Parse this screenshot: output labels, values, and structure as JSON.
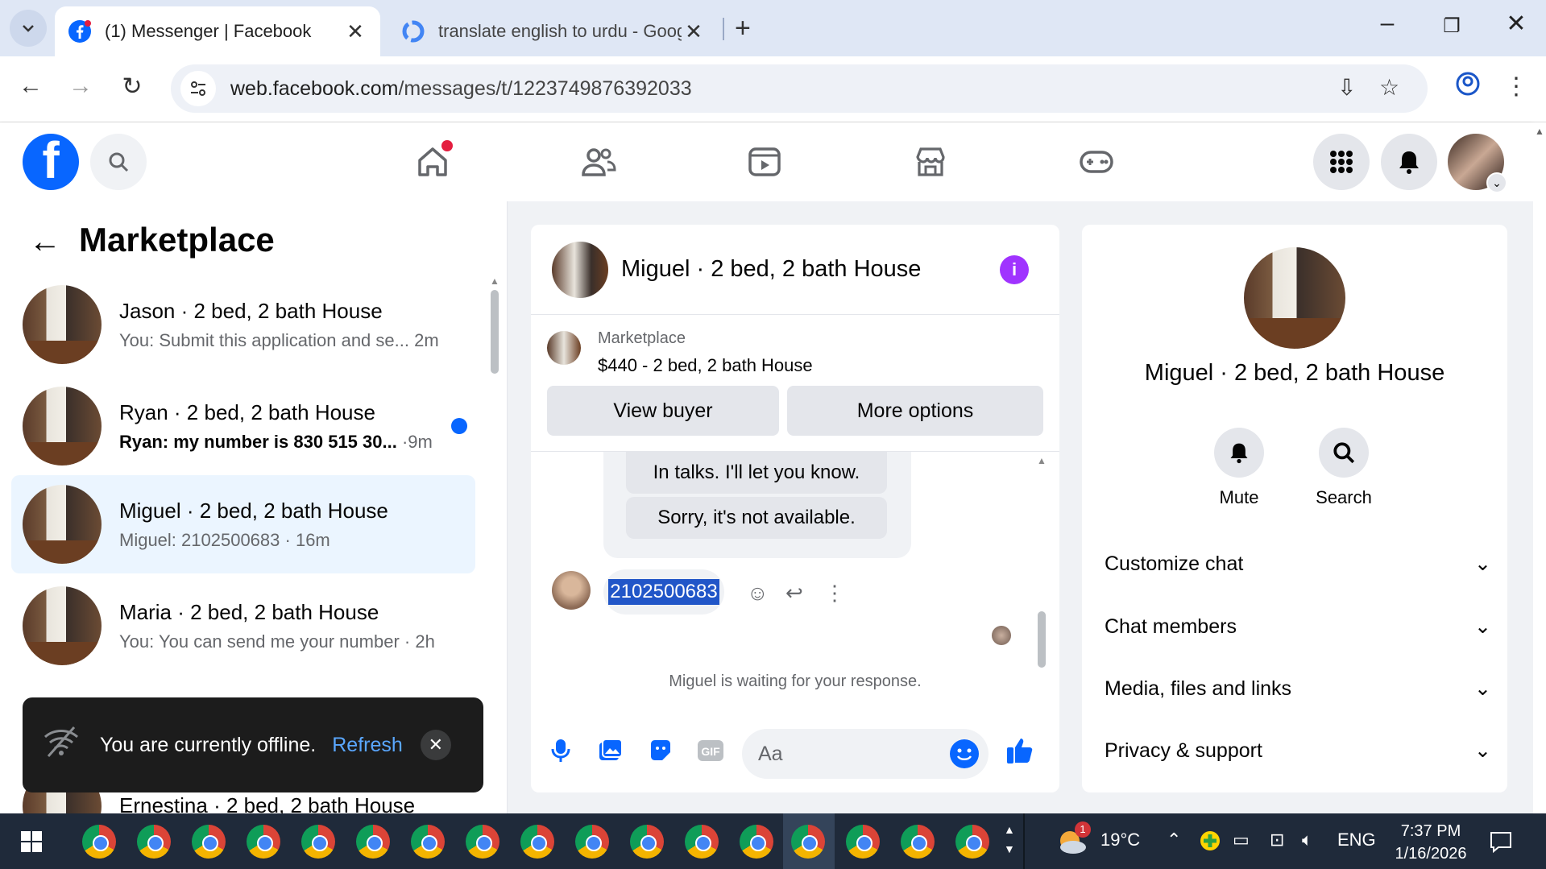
{
  "browser": {
    "tabs": [
      {
        "label": "(1) Messenger | Facebook",
        "active": true
      },
      {
        "label": "translate english to urdu - Goog",
        "active": false
      }
    ],
    "url_domain": "web.facebook.com",
    "url_path": "/messages/t/1223749876392033"
  },
  "colors": {
    "fb_blue": "#0866ff",
    "accent_purple": "#a033ff",
    "selected_row": "#ebf5ff"
  },
  "left": {
    "title": "Marketplace",
    "conversations": [
      {
        "name": "Jason · 2 bed, 2 bath House",
        "preview": "You: Submit this application and se...",
        "time": "2m",
        "unread": false
      },
      {
        "name": "Ryan · 2 bed, 2 bath House",
        "preview": "Ryan: my number is 830 515 30...",
        "time": "9m",
        "unread": true
      },
      {
        "name": "Miguel · 2 bed, 2 bath House",
        "preview": "Miguel: 2102500683",
        "time": "16m",
        "unread": false
      },
      {
        "name": "Maria · 2 bed, 2 bath House",
        "preview": "You: You can send me your number",
        "time": "2h",
        "unread": false
      },
      {
        "name": "Ernestina · 2 bed, 2 bath House"
      }
    ],
    "toast": {
      "message": "You are currently offline.",
      "action": "Refresh"
    }
  },
  "chat": {
    "title": "Miguel · 2 bed, 2 bath House",
    "listing_source": "Marketplace",
    "listing_price": "$440 - 2 bed, 2 bath House",
    "view_buyer": "View buyer",
    "more_options": "More options",
    "quick_replies": [
      "In talks. I'll let you know.",
      "Sorry, it's not available."
    ],
    "message": "2102500683",
    "waiting": "Miguel is waiting for your response.",
    "input_placeholder": "Aa"
  },
  "info": {
    "title": "Miguel · 2 bed, 2 bath House",
    "mute": "Mute",
    "search": "Search",
    "sections": [
      "Customize chat",
      "Chat members",
      "Media, files and links",
      "Privacy & support"
    ]
  },
  "taskbar": {
    "weather_badge": "1",
    "temperature": "19°C",
    "language": "ENG",
    "time": "7:37 PM",
    "date": "1/16/2026"
  }
}
